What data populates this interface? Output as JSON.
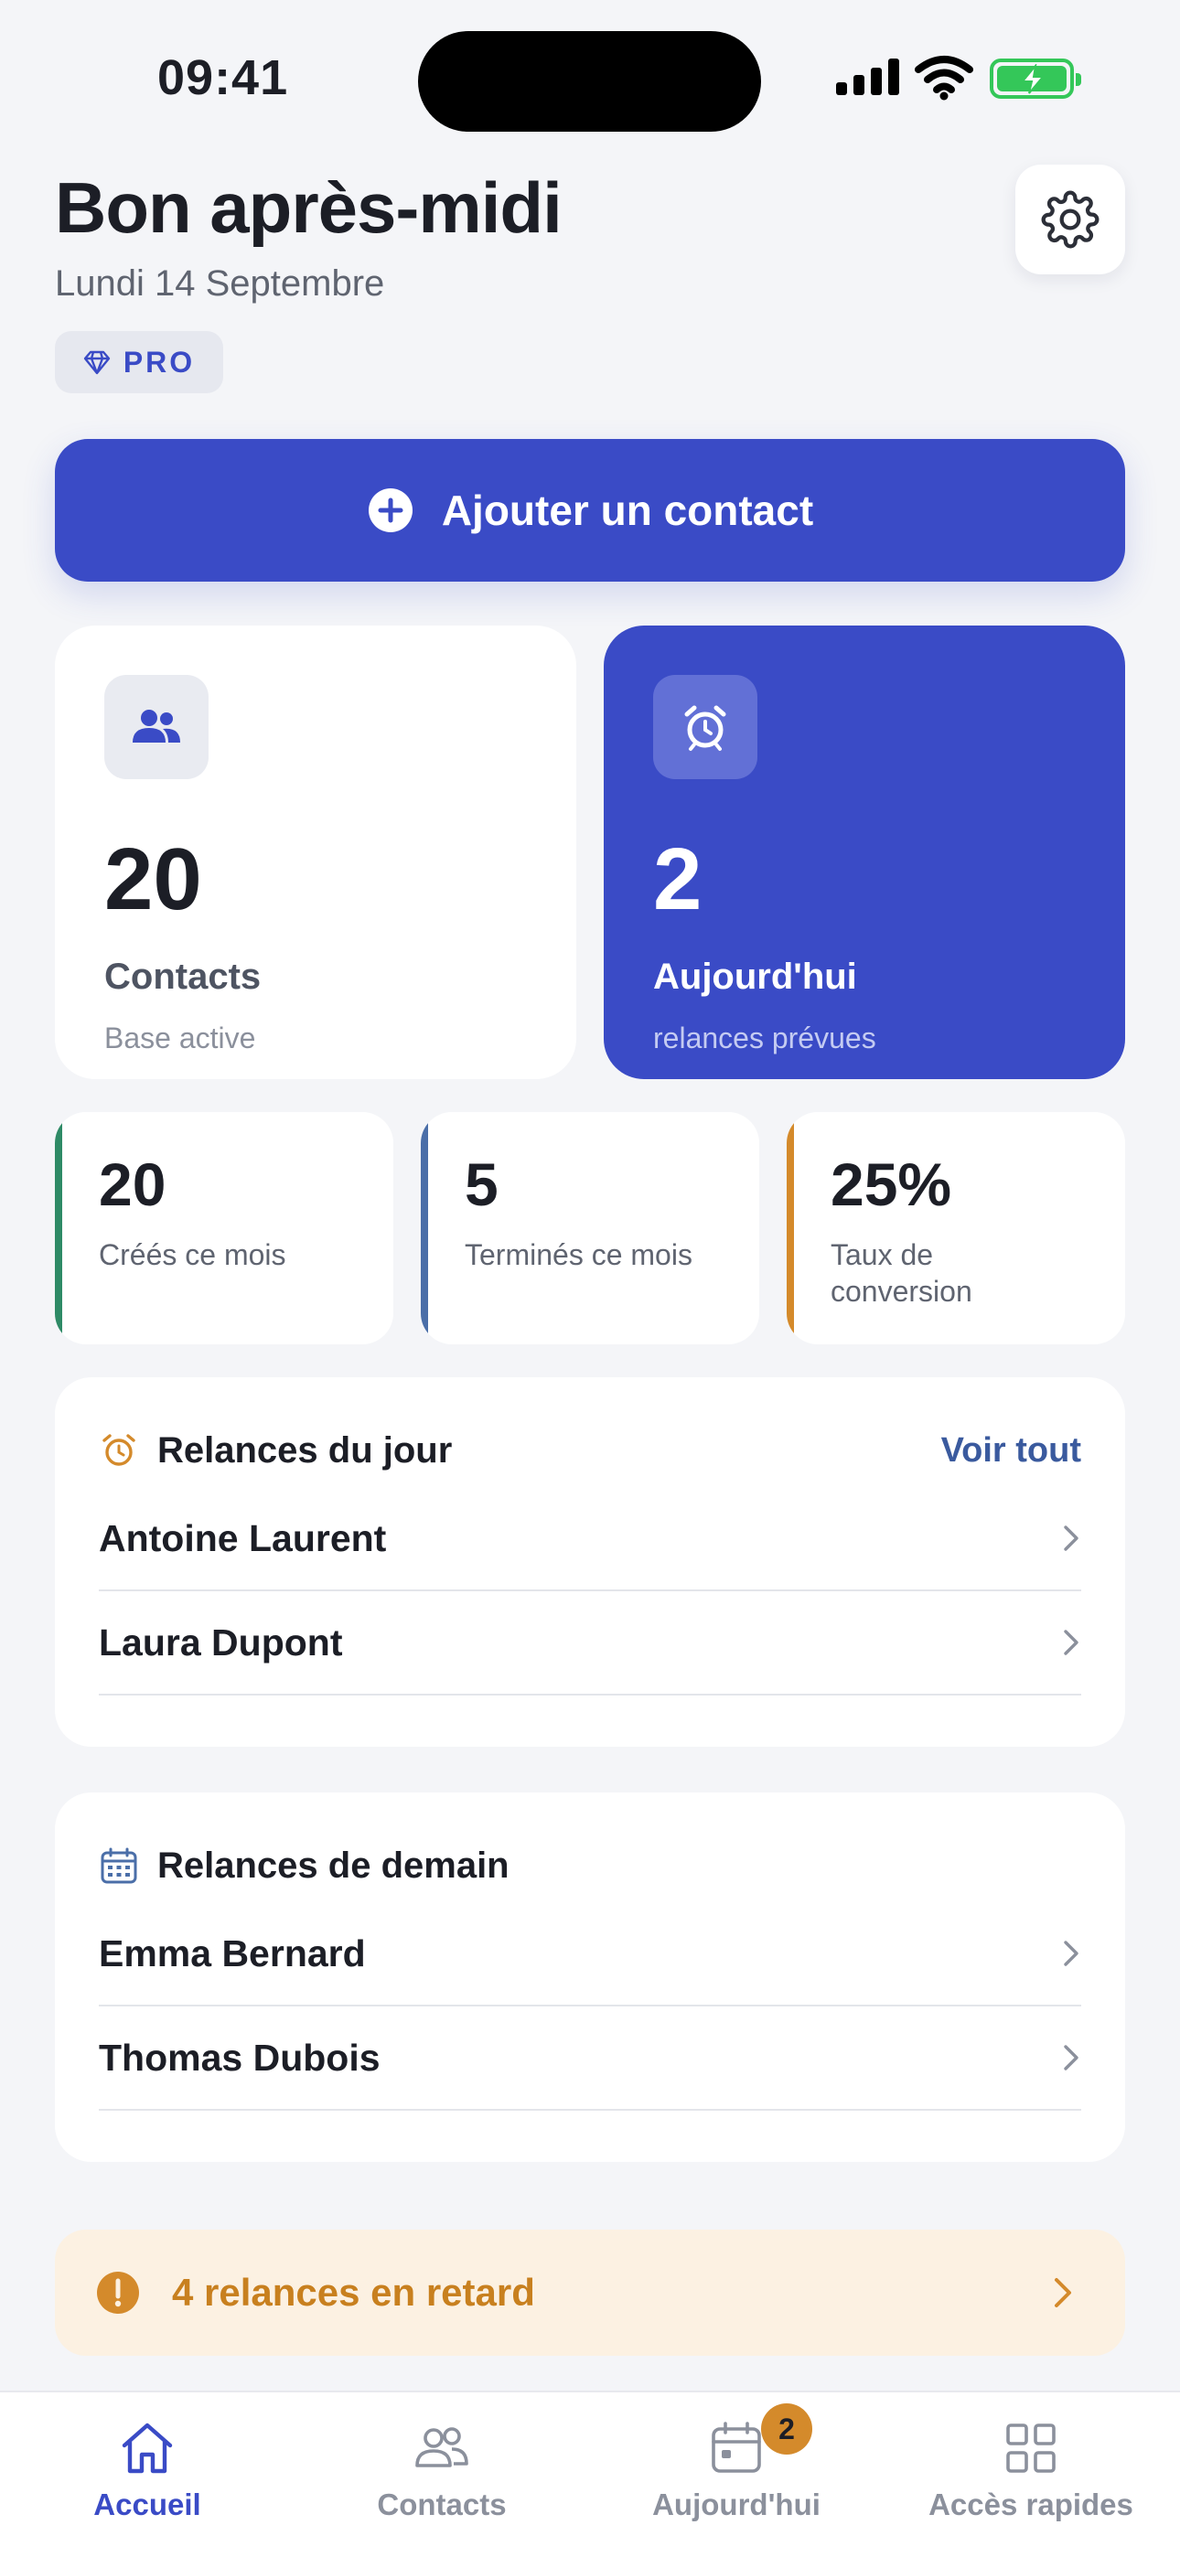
{
  "status_bar": {
    "time": "09:41"
  },
  "header": {
    "greeting": "Bon après-midi",
    "date": "Lundi 14 Septembre",
    "badge": "PRO"
  },
  "add_contact": {
    "label": "Ajouter un contact"
  },
  "stats": {
    "contacts": {
      "value": "20",
      "label": "Contacts",
      "sub": "Base active"
    },
    "today": {
      "value": "2",
      "label": "Aujourd'hui",
      "sub": "relances prévues"
    },
    "small": [
      {
        "value": "20",
        "label": "Créés ce mois",
        "accent": "#2e8a66"
      },
      {
        "value": "5",
        "label": "Terminés ce mois",
        "accent": "#4a6ea8"
      },
      {
        "value": "25%",
        "label": "Taux de conversion",
        "accent": "#d48a2b"
      }
    ]
  },
  "today_followups": {
    "title": "Relances du jour",
    "link": "Voir tout",
    "items": [
      {
        "name": "Antoine Laurent"
      },
      {
        "name": "Laura Dupont"
      }
    ]
  },
  "tomorrow_followups": {
    "title": "Relances de demain",
    "items": [
      {
        "name": "Emma Bernard"
      },
      {
        "name": "Thomas Dubois"
      }
    ]
  },
  "overdue_alert": {
    "text": "4 relances en retard"
  },
  "tabbar": {
    "tabs": [
      {
        "label": "Accueil",
        "icon": "home-icon",
        "active": true
      },
      {
        "label": "Contacts",
        "icon": "users-icon",
        "active": false
      },
      {
        "label": "Aujourd'hui",
        "icon": "calendar-icon",
        "active": false,
        "badge": "2"
      },
      {
        "label": "Accès rapides",
        "icon": "grid-icon",
        "active": false
      }
    ]
  },
  "colors": {
    "accent": "#3a4bc6",
    "background": "#f4f5f8",
    "warning": "#d48a2b",
    "warning_bg": "#fcf1e2"
  }
}
